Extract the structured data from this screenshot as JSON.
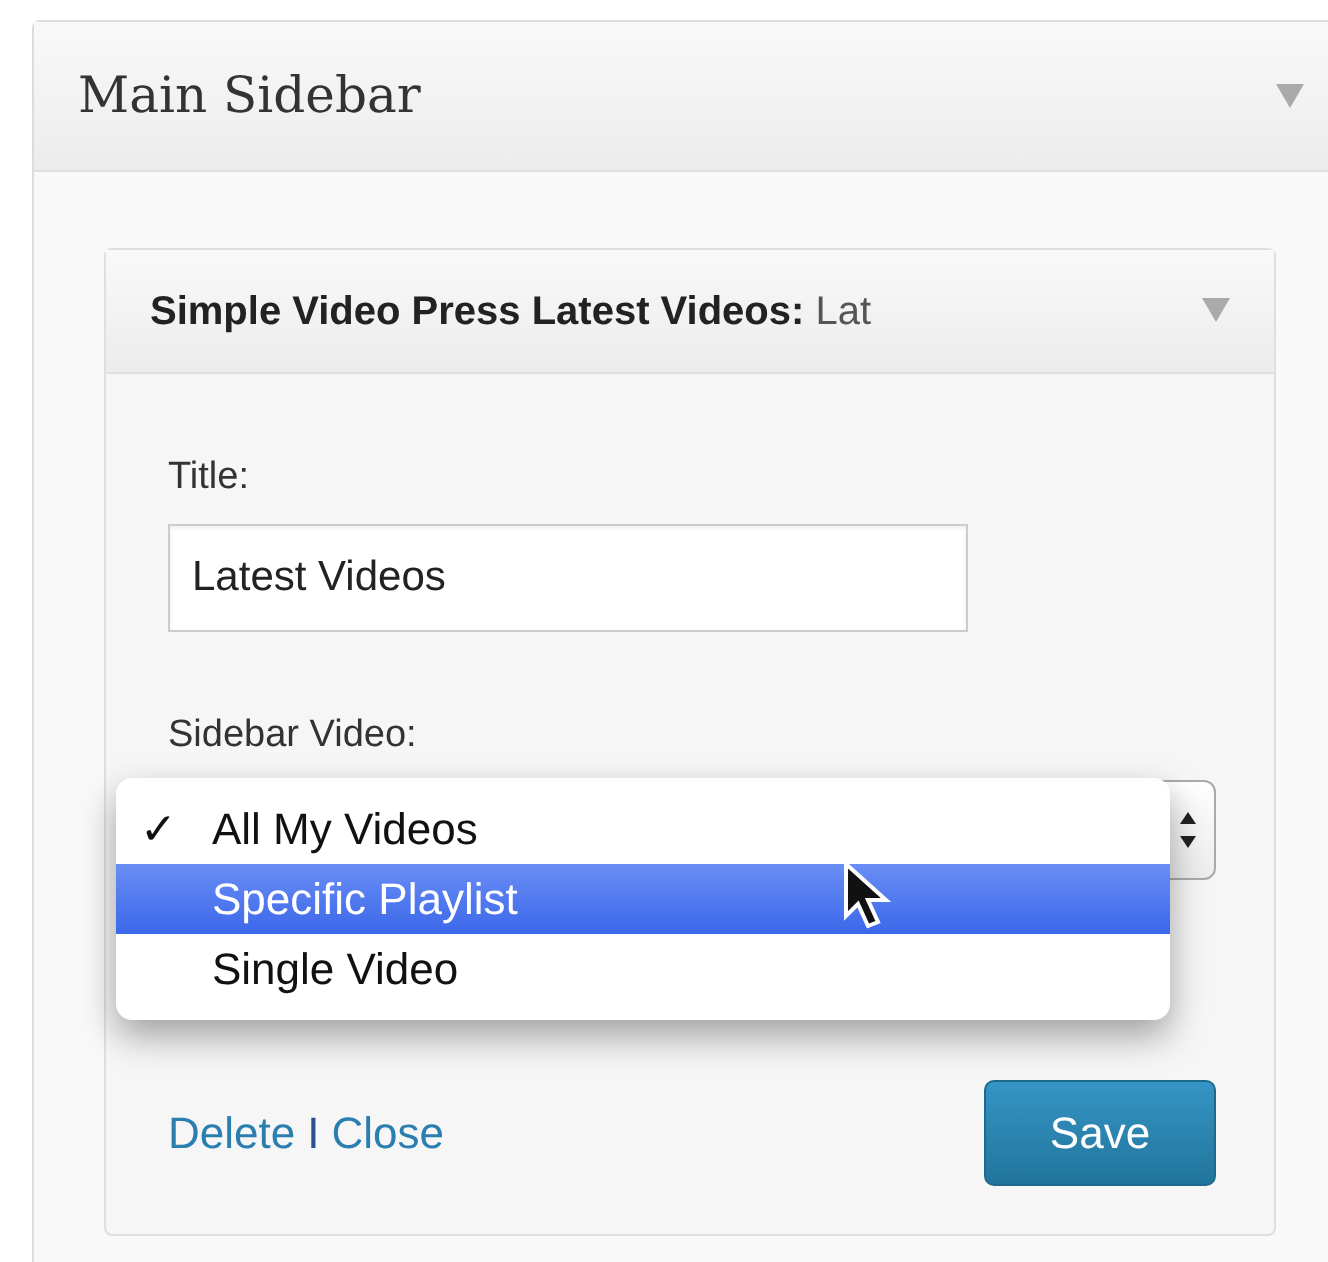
{
  "sidebar": {
    "title": "Main Sidebar",
    "expanded": true
  },
  "widget": {
    "title": "Simple Video Press Latest Videos:",
    "title_suffix": "Lat",
    "expanded": true,
    "fields": [
      {
        "kind": "text",
        "label": "Title:",
        "value": "Latest Videos"
      },
      {
        "kind": "select",
        "label": "Sidebar Video:",
        "open": true,
        "check_mark": "✓",
        "options": [
          {
            "label": "All My Videos",
            "checked": true,
            "selected": false
          },
          {
            "label": "Specific Playlist",
            "checked": false,
            "selected": true
          },
          {
            "label": "Single Video",
            "checked": false,
            "selected": false
          }
        ]
      }
    ],
    "links": [
      "Delete",
      "Close"
    ],
    "separator": "I",
    "save_button": "Save"
  }
}
